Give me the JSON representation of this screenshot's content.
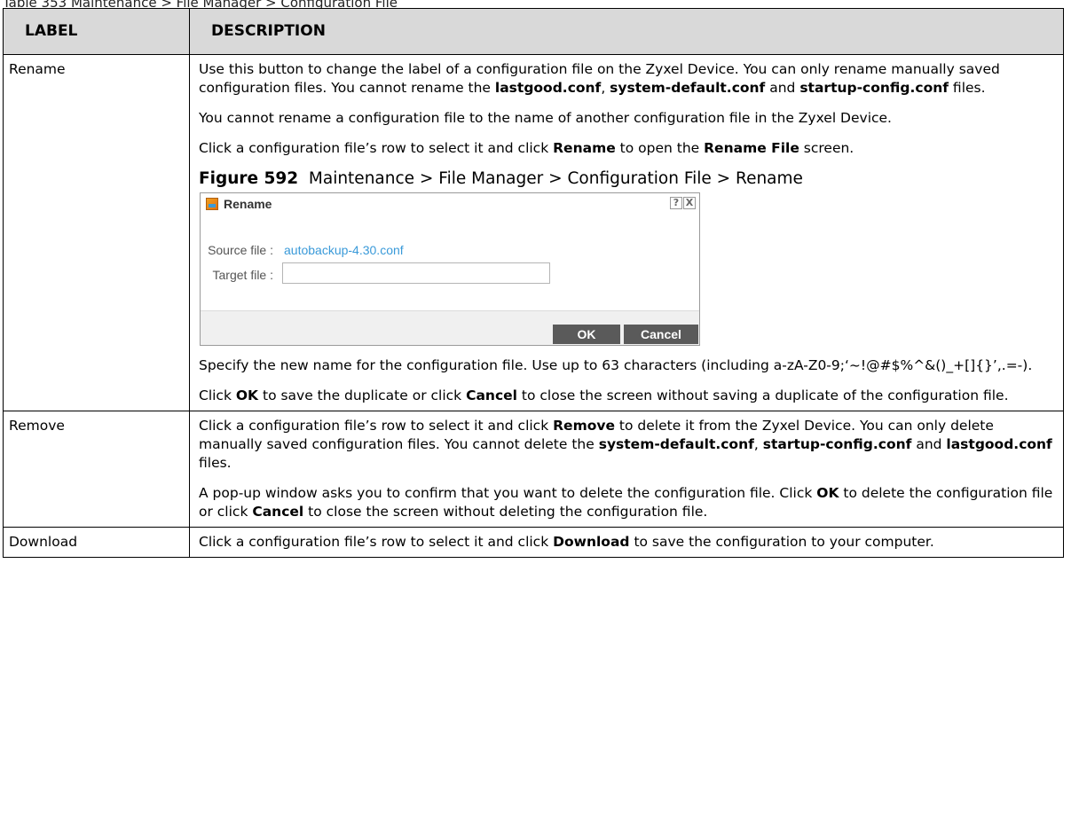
{
  "caption": "Table 353   Maintenance > File Manager > Configuration File",
  "table": {
    "header_label": "LABEL",
    "header_description": "DESCRIPTION"
  },
  "rows": {
    "rename": {
      "label": "Rename",
      "p1": [
        "Use this button to change the label of a configuration file on the Zyxel Device. You can only rename manually saved configuration files. You cannot rename the ",
        "lastgood.conf",
        ", ",
        "system-default.conf",
        " and ",
        "startup-config.conf",
        " files."
      ],
      "p2": "You cannot rename a configuration file to the name of another configuration file in the Zyxel Device.",
      "p3": [
        "Click a configuration file’s row to select it and click ",
        "Rename",
        " to open the ",
        "Rename File",
        " screen."
      ],
      "figure_number": "Figure 592",
      "figure_title": "Maintenance > File Manager > Configuration File > Rename",
      "dialog": {
        "title": "Rename",
        "help_icon": "?",
        "close_icon": "X",
        "source_label": "Source file :",
        "source_value": "autobackup-4.30.conf",
        "target_label": "Target file :",
        "target_value": "",
        "ok_label": "OK",
        "cancel_label": "Cancel"
      },
      "p4": "Specify the new name for the configuration file. Use up to 63 characters (including a-zA-Z0-9;‘~!@#$%^&()_+[]{}’,.=-).",
      "p5": [
        "Click ",
        "OK",
        " to save the duplicate or click ",
        "Cancel",
        " to close the screen without saving a duplicate of the configuration file."
      ]
    },
    "remove": {
      "label": "Remove",
      "p1": [
        "Click a configuration file’s row to select it and click ",
        "Remove",
        " to delete it from the Zyxel Device. You can only delete manually saved configuration files. You cannot delete the ",
        "system-default.conf",
        ", ",
        "startup-config.conf",
        " and ",
        "lastgood.conf",
        " files."
      ],
      "p2": [
        "A pop-up window asks you to confirm that you want to delete the configuration file. Click ",
        "OK",
        " to delete the configuration file or click ",
        "Cancel",
        " to close the screen without deleting the configuration file."
      ]
    },
    "download": {
      "label": "Download",
      "p1": [
        "Click a configuration file’s row to select it and click ",
        "Download",
        " to save the configuration to your computer."
      ]
    }
  }
}
